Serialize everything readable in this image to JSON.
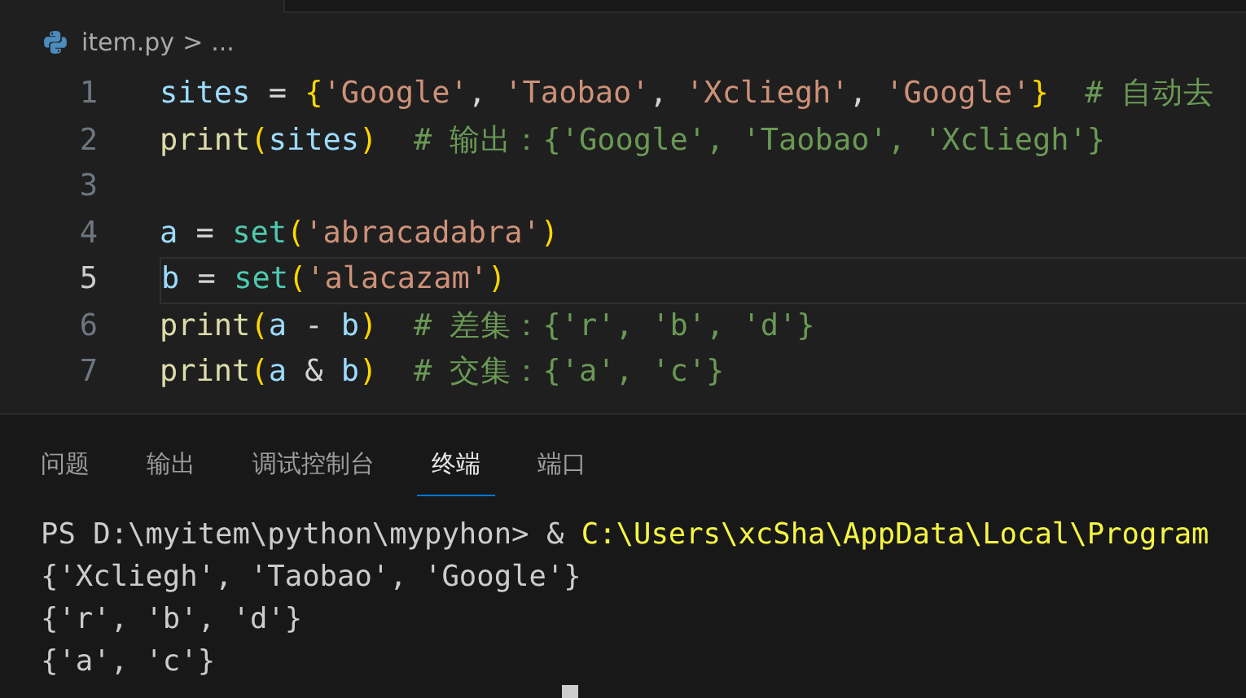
{
  "breadcrumb": {
    "file": "item.py",
    "separator": ">",
    "rest": "..."
  },
  "editor": {
    "lines": [
      {
        "number": "1",
        "current": false,
        "tokens": [
          {
            "kind": "var",
            "text": "sites"
          },
          {
            "kind": "op",
            "text": " = "
          },
          {
            "kind": "bracket",
            "text": "{"
          },
          {
            "kind": "string",
            "text": "'Google'"
          },
          {
            "kind": "op",
            "text": ", "
          },
          {
            "kind": "string",
            "text": "'Taobao'"
          },
          {
            "kind": "op",
            "text": ", "
          },
          {
            "kind": "string",
            "text": "'Xcliegh'"
          },
          {
            "kind": "op",
            "text": ", "
          },
          {
            "kind": "string",
            "text": "'Google'"
          },
          {
            "kind": "bracket",
            "text": "}"
          },
          {
            "kind": "comment",
            "text": "  # 自动去"
          }
        ]
      },
      {
        "number": "2",
        "current": false,
        "tokens": [
          {
            "kind": "func",
            "text": "print"
          },
          {
            "kind": "bracket",
            "text": "("
          },
          {
            "kind": "var",
            "text": "sites"
          },
          {
            "kind": "bracket",
            "text": ")"
          },
          {
            "kind": "comment",
            "text": "  # 输出：{'Google', 'Taobao', 'Xcliegh'}"
          }
        ]
      },
      {
        "number": "3",
        "current": false
      },
      {
        "number": "4",
        "current": false,
        "tokens": [
          {
            "kind": "var",
            "text": "a"
          },
          {
            "kind": "op",
            "text": " = "
          },
          {
            "kind": "class",
            "text": "set"
          },
          {
            "kind": "bracket",
            "text": "("
          },
          {
            "kind": "string",
            "text": "'abracadabra'"
          },
          {
            "kind": "bracket",
            "text": ")"
          }
        ]
      },
      {
        "number": "5",
        "current": true,
        "tokens": [
          {
            "kind": "var",
            "text": "b"
          },
          {
            "kind": "op",
            "text": " = "
          },
          {
            "kind": "class",
            "text": "set"
          },
          {
            "kind": "bracket",
            "text": "("
          },
          {
            "kind": "string",
            "text": "'alacazam'"
          },
          {
            "kind": "bracket",
            "text": ")"
          }
        ]
      },
      {
        "number": "6",
        "current": false,
        "tokens": [
          {
            "kind": "func",
            "text": "print"
          },
          {
            "kind": "bracket",
            "text": "("
          },
          {
            "kind": "var",
            "text": "a"
          },
          {
            "kind": "op",
            "text": " - "
          },
          {
            "kind": "var",
            "text": "b"
          },
          {
            "kind": "bracket",
            "text": ")"
          },
          {
            "kind": "comment",
            "text": "  # 差集：{'r', 'b', 'd'}"
          }
        ]
      },
      {
        "number": "7",
        "current": false,
        "tokens": [
          {
            "kind": "func",
            "text": "print"
          },
          {
            "kind": "bracket",
            "text": "("
          },
          {
            "kind": "var",
            "text": "a"
          },
          {
            "kind": "op",
            "text": " & "
          },
          {
            "kind": "var",
            "text": "b"
          },
          {
            "kind": "bracket",
            "text": ")"
          },
          {
            "kind": "comment",
            "text": "  # 交集：{'a', 'c'}"
          }
        ]
      }
    ]
  },
  "panel_tabs": [
    {
      "label": "问题",
      "selected": false
    },
    {
      "label": "输出",
      "selected": false
    },
    {
      "label": "调试控制台",
      "selected": false
    },
    {
      "label": "终端",
      "selected": true
    },
    {
      "label": "端口",
      "selected": false
    }
  ],
  "terminal": {
    "lines": [
      {
        "kind": "command",
        "prompt": "PS D:\\myitem\\python\\mypyhon> & ",
        "command": "C:\\Users\\xcSha\\AppData\\Local\\Program"
      },
      {
        "kind": "output",
        "text": "{'Xcliegh', 'Taobao', 'Google'}"
      },
      {
        "kind": "output",
        "text": "{'r', 'b', 'd'}"
      },
      {
        "kind": "output",
        "text": "{'a', 'c'}"
      },
      {
        "kind": "cursor"
      }
    ]
  }
}
